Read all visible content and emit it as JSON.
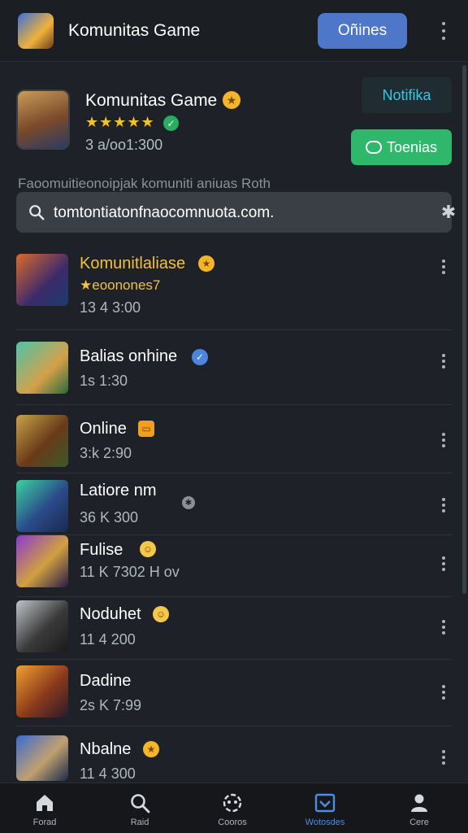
{
  "topbar": {
    "title": "Komunitas Game",
    "online_button": "Oñines"
  },
  "header_card": {
    "title": "Komunitas Game",
    "rating_stars": "★★★★★",
    "meta": "3 a/oo1:300",
    "notif_button": "Notifika",
    "forums_button": "Toenias"
  },
  "description": "Faoomuitieonoipjak komuniti aniuas Roth",
  "search": {
    "value": "tomtontiatonfnaocomnuota.com."
  },
  "list": {
    "items": [
      {
        "name": "Komunitlaliase",
        "sub": "★eoonones7",
        "meta": "13 4 3:00",
        "name_color": "#f2c23a"
      },
      {
        "name": "Balias onhine",
        "sub": "",
        "meta": "1s 1:30",
        "name_color": "#ffffff"
      },
      {
        "name": "Online",
        "sub": "",
        "meta": "3:k 2:90",
        "name_color": "#ffffff"
      },
      {
        "name": "Latiore nm",
        "sub": "",
        "meta": "36 K 300",
        "name_color": "#ffffff"
      },
      {
        "name": "Fulise",
        "sub": "",
        "meta": "11 K 7302 H ov",
        "name_color": "#ffffff"
      },
      {
        "name": "Noduhet",
        "sub": "",
        "meta": "11 4 200",
        "name_color": "#ffffff"
      },
      {
        "name": "Dadine",
        "sub": "",
        "meta": "2s K 7:99",
        "name_color": "#ffffff"
      },
      {
        "name": "Nbalne",
        "sub": "",
        "meta": "11 4 300",
        "name_color": "#ffffff"
      }
    ]
  },
  "bottom_nav": [
    {
      "label": "Forad",
      "icon": "home-icon"
    },
    {
      "label": "Raid",
      "icon": "search-icon"
    },
    {
      "label": "Cooros",
      "icon": "controller-icon"
    },
    {
      "label": "Wotosdes",
      "icon": "checkbox-icon",
      "active": true
    },
    {
      "label": "Cere",
      "icon": "profile-icon"
    }
  ],
  "colors": {
    "background": "#1e2127",
    "accent_blue": "#4f77c9",
    "accent_green": "#2fb86b",
    "notif_cyan": "#38c7e3",
    "gold": "#f2c23a"
  }
}
